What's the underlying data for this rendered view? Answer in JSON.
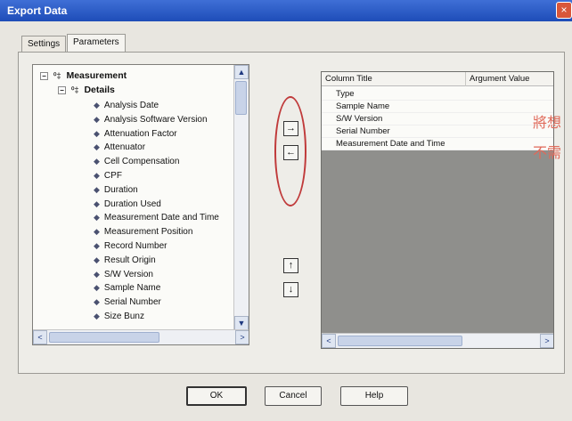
{
  "window": {
    "title": "Export Data",
    "close_glyph": "×"
  },
  "tabs": [
    {
      "label": "Settings"
    },
    {
      "label": "Parameters"
    }
  ],
  "tree": {
    "root": {
      "label": "Measurement",
      "toggle": "−",
      "icon": "⁰‡"
    },
    "group": {
      "label": "Details",
      "toggle": "−",
      "icon": "⁰‡"
    },
    "leaf_icon": "◆",
    "items": [
      "Analysis Date",
      "Analysis Software Version",
      "Attenuation Factor",
      "Attenuator",
      "Cell Compensation",
      "CPF",
      "Duration",
      "Duration Used",
      "Measurement Date and Time",
      "Measurement Position",
      "Record Number",
      "Result Origin",
      "S/W Version",
      "Sample Name",
      "Serial Number",
      "Size Bunz"
    ],
    "scroll": {
      "up": "▲",
      "down": "▼",
      "left": "<",
      "right": ">"
    }
  },
  "move_buttons": {
    "add": "→",
    "remove": "←",
    "up": "↑",
    "down": "↓"
  },
  "grid": {
    "columns": [
      "Column Title",
      "Argument Value"
    ],
    "rows": [
      "Type",
      "Sample Name",
      "S/W Version",
      "Serial Number",
      "Measurement Date and Time"
    ],
    "scroll": {
      "left": "<",
      "right": ">"
    }
  },
  "annotation": {
    "line1": "將想",
    "line2": "不需"
  },
  "buttons": {
    "ok": "OK",
    "cancel": "Cancel",
    "help": "Help"
  }
}
